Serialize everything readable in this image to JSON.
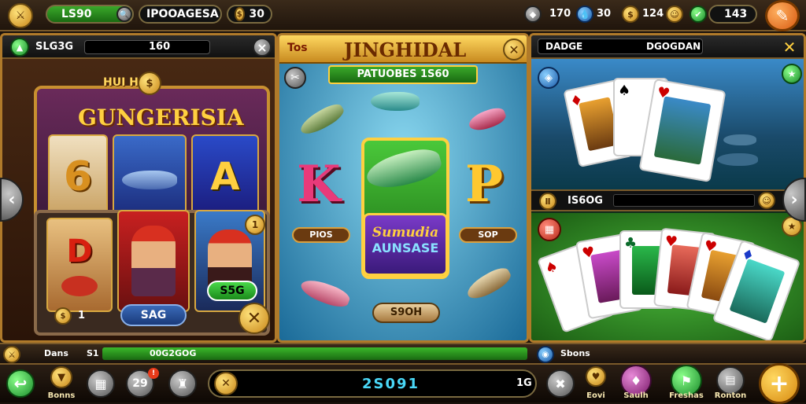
{
  "topbar": {
    "level": "LS90",
    "player_name": "IPOOAGESA",
    "gold": "30",
    "stat1": "170",
    "stat2": "30",
    "stat3": "124",
    "stat4": "143"
  },
  "left_panel": {
    "header_label": "SLG3G",
    "header_value": "160",
    "banner_small": "HUI HUO",
    "title": "GUNGERISIA",
    "reel_6": "6",
    "reel_a": "A",
    "card_d": "D",
    "badge_1": "1",
    "value_badge": "S5G",
    "footer_number": "1",
    "footer_button": "SAG"
  },
  "center_panel": {
    "corner_tag": "Tos",
    "title": "JINGHIDAL",
    "banner": "PATUOBES 1S60",
    "letter_k": "K",
    "letter_p": "P",
    "plate_left": "PIOS",
    "plate_right": "SOP",
    "logo_line1": "Sumudia",
    "logo_line2": "AUNSASE",
    "bottom_button": "S9OH"
  },
  "right_panel": {
    "header_label": "DADGE",
    "header_value": "DGOGDAN",
    "bar_value": "IS6OG"
  },
  "bottom_strip": {
    "label1": "Dans",
    "label2": "S1",
    "value": "00G2GOG",
    "right_label": "Sbons"
  },
  "bottom_bar": {
    "btn1_label": "Bonns",
    "btn2_label": "",
    "btn3_num": "29",
    "center_value": "2S091",
    "center_right": "1G",
    "lbl_love": "Eovi",
    "lbl_saulh": "Saulh",
    "lbl_freshas": "Freshas",
    "lbl_ronton": "Ronton"
  },
  "colors": {
    "gold": "#e8b43a",
    "dark_bg": "#1a120c",
    "green_bar": "#2a8a1a",
    "blue_water": "#2a8ac8"
  }
}
